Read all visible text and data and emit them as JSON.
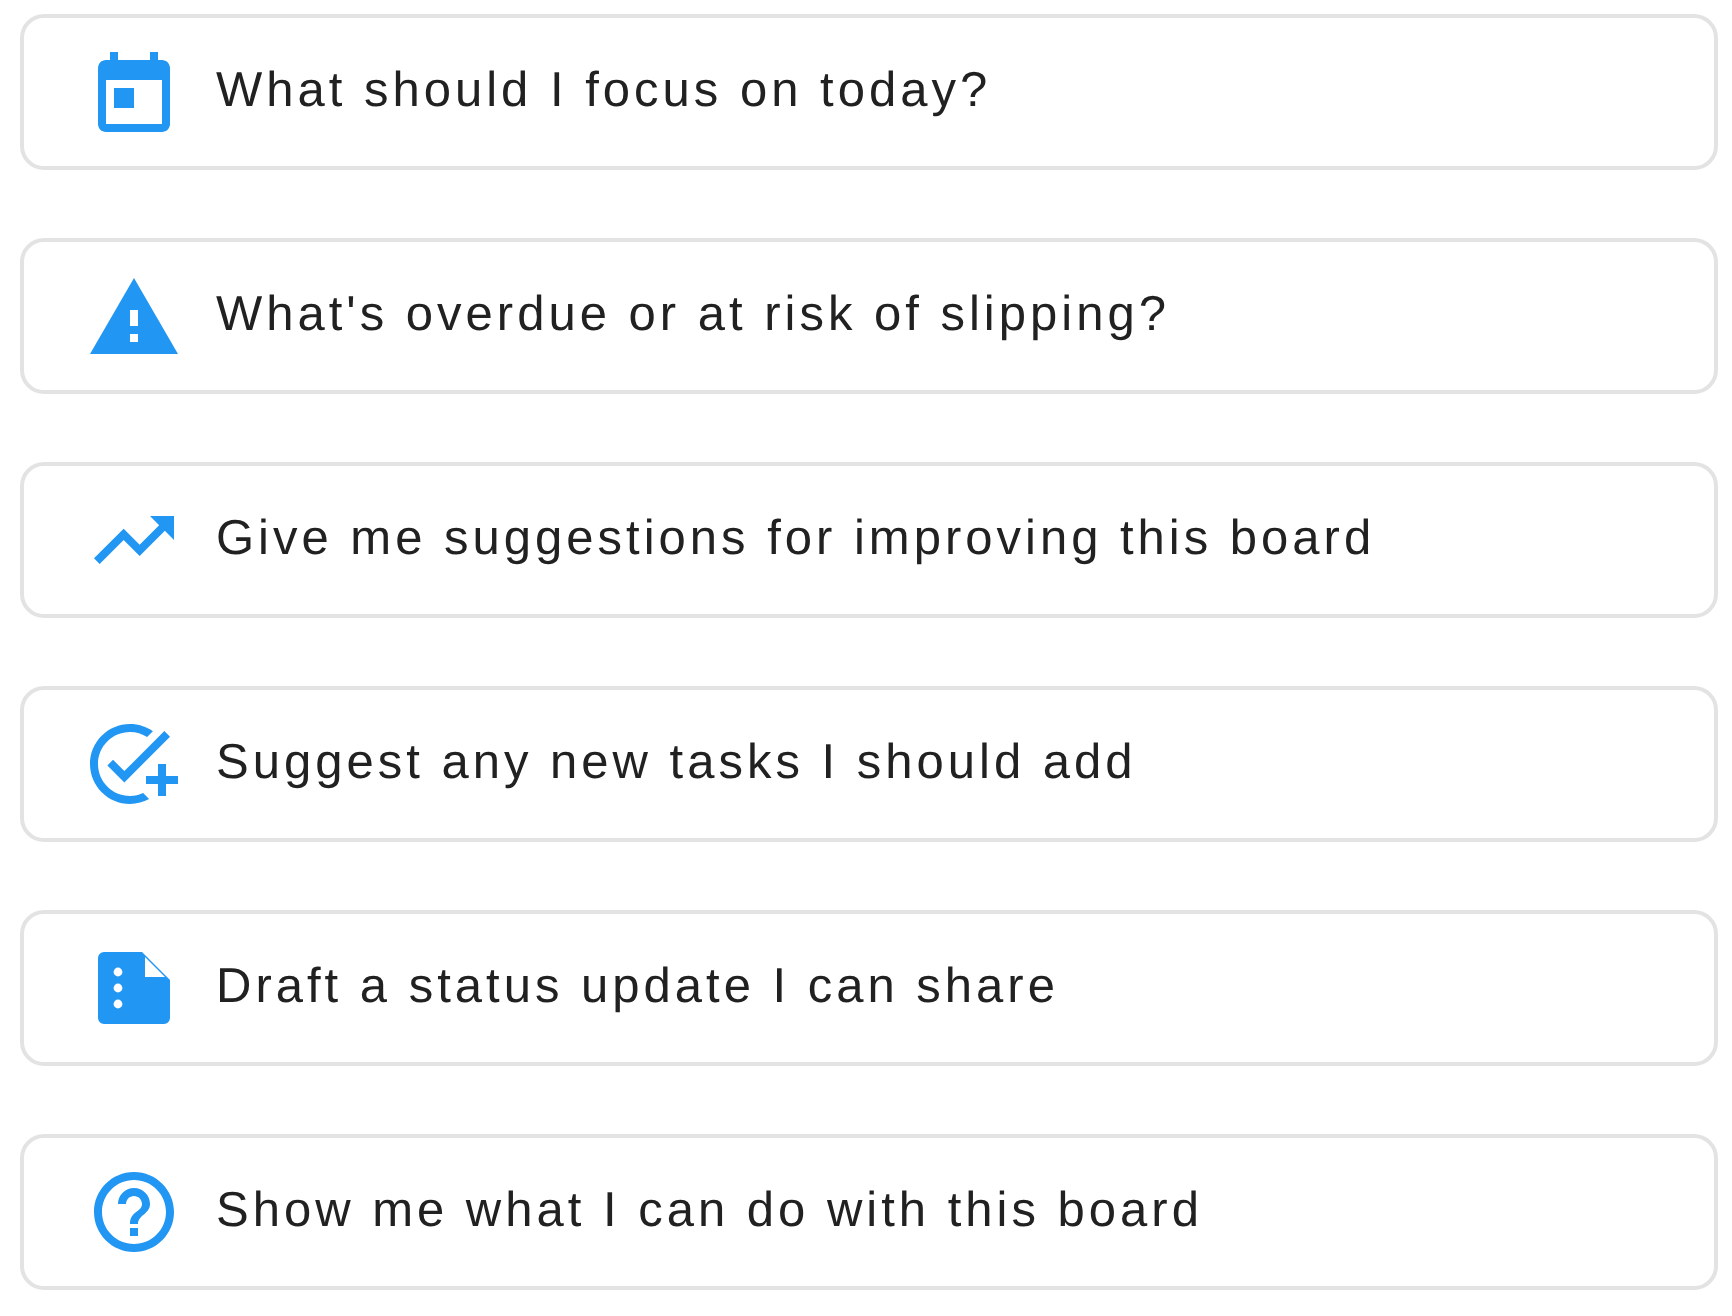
{
  "suggestions": [
    {
      "label": "What should I focus on today?"
    },
    {
      "label": "What's overdue or at risk of slipping?"
    },
    {
      "label": "Give me suggestions for improving this board"
    },
    {
      "label": "Suggest any new tasks I should add"
    },
    {
      "label": "Draft a status update I can share"
    },
    {
      "label": "Show me what I can do with this board"
    }
  ]
}
